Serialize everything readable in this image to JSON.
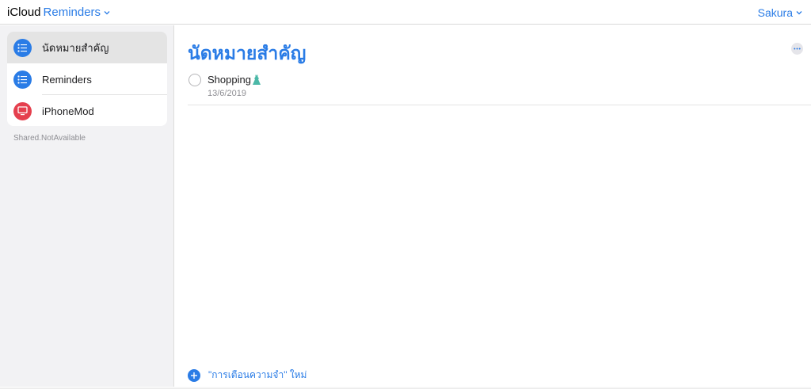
{
  "header": {
    "brand": "iCloud",
    "app": "Reminders",
    "user": "Sakura"
  },
  "sidebar": {
    "items": [
      {
        "label": "นัดหมายสำคัญ",
        "icon": "list-bullet-icon",
        "color": "#2a7ce6",
        "selected": true
      },
      {
        "label": "Reminders",
        "icon": "list-bullet-icon",
        "color": "#2a7ce6",
        "selected": false
      },
      {
        "label": "iPhoneMod",
        "icon": "tv-icon",
        "color": "#e5404e",
        "selected": false
      }
    ],
    "shared_note": "Shared.NotAvailable"
  },
  "main": {
    "title": "นัดหมายสำคัญ",
    "reminders": [
      {
        "title": "Shopping",
        "date": "13/6/2019",
        "icon": "dress-icon"
      }
    ],
    "add_label": "\"การเตือนความจำ\" ใหม่"
  },
  "colors": {
    "accent": "#2a7ce6",
    "red": "#e5404e"
  }
}
